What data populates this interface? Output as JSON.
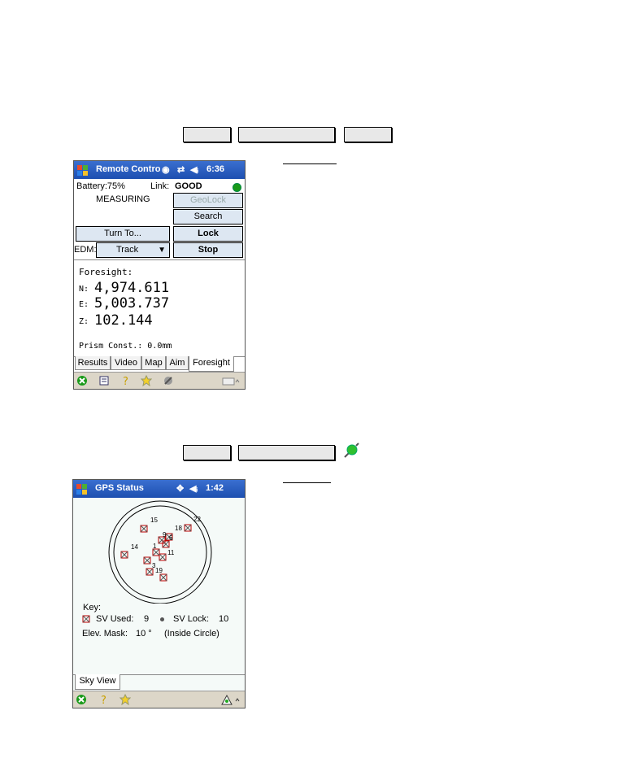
{
  "screen1": {
    "title": "Remote Contro",
    "time": "6:36",
    "battery": "Battery:75%",
    "link_label": "Link:",
    "link_value": "GOOD",
    "measuring": "MEASURING",
    "geolock": "GeoLock",
    "search": "Search",
    "turn_to": "Turn To...",
    "lock": "Lock",
    "edm_label": "EDM:",
    "edm_value": "Track",
    "stop": "Stop",
    "foresight_heading": "Foresight:",
    "n_label": "N:",
    "n_value": "4,974.611",
    "e_label": "E:",
    "e_value": "5,003.737",
    "z_label": "Z:",
    "z_value": "102.144",
    "prism": "Prism Const.: 0.0mm",
    "tabs": [
      "Results",
      "Video",
      "Map",
      "Aim",
      "Foresight"
    ],
    "menu_icons": [
      "close-icon",
      "checklist-icon",
      "help-icon",
      "favorites-icon",
      "tools-icon",
      "keyboard-icon"
    ]
  },
  "screen2": {
    "title": "GPS Status",
    "time": "1:42",
    "satellites": [
      "15",
      "22",
      "18",
      "9",
      "6",
      "14",
      "1",
      "11",
      "3",
      "19"
    ],
    "key_label": "Key:",
    "sv_used_label": "SV Used:",
    "sv_used_value": "9",
    "sv_lock_label": "SV Lock:",
    "sv_lock_value": "10",
    "elev_mask_label": "Elev. Mask:",
    "elev_mask_value": "10 °",
    "inside_circle": "(Inside Circle)",
    "tab": "Sky View",
    "menu_icons": [
      "close-icon",
      "help-icon",
      "favorites-icon",
      "gps-icon"
    ]
  },
  "colors": {
    "titlebar": "#1d4fb0",
    "button_fill": "#dde7f2",
    "menubar": "#dcd6c8",
    "link_ok": "#1a9a1a",
    "sat_red": "#c00000"
  }
}
